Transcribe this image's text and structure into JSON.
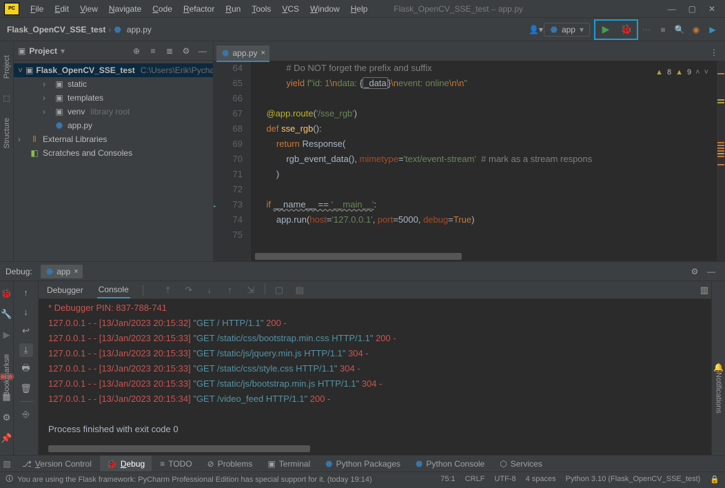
{
  "app_title": "Flask_OpenCV_SSE_test – app.py",
  "menu": [
    "File",
    "Edit",
    "View",
    "Navigate",
    "Code",
    "Refactor",
    "Run",
    "Tools",
    "VCS",
    "Window",
    "Help"
  ],
  "breadcrumb": {
    "project": "Flask_OpenCV_SSE_test",
    "file": "app.py"
  },
  "config_name": "app",
  "project_tree": {
    "title": "Project",
    "root": "Flask_OpenCV_SSE_test",
    "root_path": "C:\\Users\\Erik\\Pycharm",
    "items": [
      {
        "label": "static",
        "kind": "folder",
        "depth": 1
      },
      {
        "label": "templates",
        "kind": "folder",
        "depth": 1
      },
      {
        "label": "venv",
        "kind": "folder",
        "depth": 1,
        "dim": "library root"
      },
      {
        "label": "app.py",
        "kind": "py",
        "depth": 1
      }
    ],
    "ext_libs": "External Libraries",
    "scratches": "Scratches and Consoles"
  },
  "editor": {
    "tab_label": "app.py",
    "warn_a": "8",
    "warn_b": "9",
    "lines": [
      {
        "n": "64",
        "html": "            <span class='cmt'># Do NOT forget the prefix and suffix</span>"
      },
      {
        "n": "65",
        "html": "            <span class='kw'>yield </span><span class='str'>f\"id: 1</span><span class='kw'>\\n</span><span class='str'>data: </span>{<span class='boxed'>_data</span>}<span class='kw'>\\n</span><span class='str'>event: online</span><span class='kw'>\\n\\n</span><span class='str'>\"</span>"
      },
      {
        "n": "66",
        "html": ""
      },
      {
        "n": "67",
        "html": "    <span class='dec'>@app.route</span>(<span class='str'>'/sse_rgb'</span>)"
      },
      {
        "n": "68",
        "html": "    <span class='kw'>def </span><span class='fn'>sse_rgb</span>():"
      },
      {
        "n": "69",
        "html": "        <span class='kw'>return</span> Response("
      },
      {
        "n": "70",
        "html": "            rgb_event_data(), <span class='param'>mimetype</span>=<span class='str'>'text/event-stream'</span>  <span class='cmt'># mark as a stream respons</span>"
      },
      {
        "n": "71",
        "html": "        )"
      },
      {
        "n": "72",
        "html": ""
      },
      {
        "n": "73",
        "html": "    <span class='kw'>if</span> <span class='dotted'>__name__ == </span><span class='str dotted'>'__main__'</span>:",
        "run": true
      },
      {
        "n": "74",
        "html": "        app.run(<span class='param'>host</span>=<span class='str'>'127.0.0.1'</span>, <span class='param'>port</span>=<span class='cls'>5000</span>, <span class='param'>debug</span>=<span class='kw'>True</span>)"
      },
      {
        "n": "75",
        "html": ""
      }
    ]
  },
  "debug": {
    "title": "Debug:",
    "config": "app",
    "tabs": {
      "debugger": "Debugger",
      "console": "Console"
    },
    "console_lines": [
      {
        "html": " <span class='red'>* Debugger PIN: 837-788-741</span>"
      },
      {
        "html": "<span class='red'>127.0.0.1 - - [13/Jan/2023 20:15:32] </span><span class='teal'>\"GET / HTTP/1.1\"</span><span class='red'> 200 -</span>"
      },
      {
        "html": "<span class='red'>127.0.0.1 - - [13/Jan/2023 20:15:33] </span><span class='teal'>\"GET /static/css/bootstrap.min.css HTTP/1.1\"</span><span class='red'> 200 -</span>"
      },
      {
        "html": "<span class='red'>127.0.0.1 - - [13/Jan/2023 20:15:33] </span><span class='teal'>\"GET /static/js/jquery.min.js HTTP/1.1\"</span><span class='red'> 304 -</span>"
      },
      {
        "html": "<span class='red'>127.0.0.1 - - [13/Jan/2023 20:15:33] </span><span class='teal'>\"GET /static/css/style.css HTTP/1.1\"</span><span class='red'> 304 -</span>"
      },
      {
        "html": "<span class='red'>127.0.0.1 - - [13/Jan/2023 20:15:33] </span><span class='teal'>\"GET /static/js/bootstrap.min.js HTTP/1.1\"</span><span class='red'> 304 -</span>"
      },
      {
        "html": "<span class='red'>127.0.0.1 - - [13/Jan/2023 20:15:34] </span><span class='teal'>\"GET /video_feed HTTP/1.1\"</span><span class='red'> 200 -</span>"
      },
      {
        "html": ""
      },
      {
        "html": "Process finished with exit code 0"
      }
    ]
  },
  "bottom_tools": {
    "version_control": "Version Control",
    "debug": "Debug",
    "todo": "TODO",
    "problems": "Problems",
    "terminal": "Terminal",
    "python_packages": "Python Packages",
    "python_console": "Python Console",
    "services": "Services"
  },
  "right_side": {
    "notifications": "Notifications",
    "bookmarks": "Bookmarks"
  },
  "left_side": {
    "project": "Project",
    "structure": "Structure"
  },
  "status": {
    "message": "You are using the Flask framework: PyCharm Professional Edition has special support for it. (today 19:14)",
    "caret": "75:1",
    "lineend": "CRLF",
    "encoding": "UTF-8",
    "indent": "4 spaces",
    "interpreter": "Python 3.10 (Flask_OpenCV_SSE_test)"
  }
}
